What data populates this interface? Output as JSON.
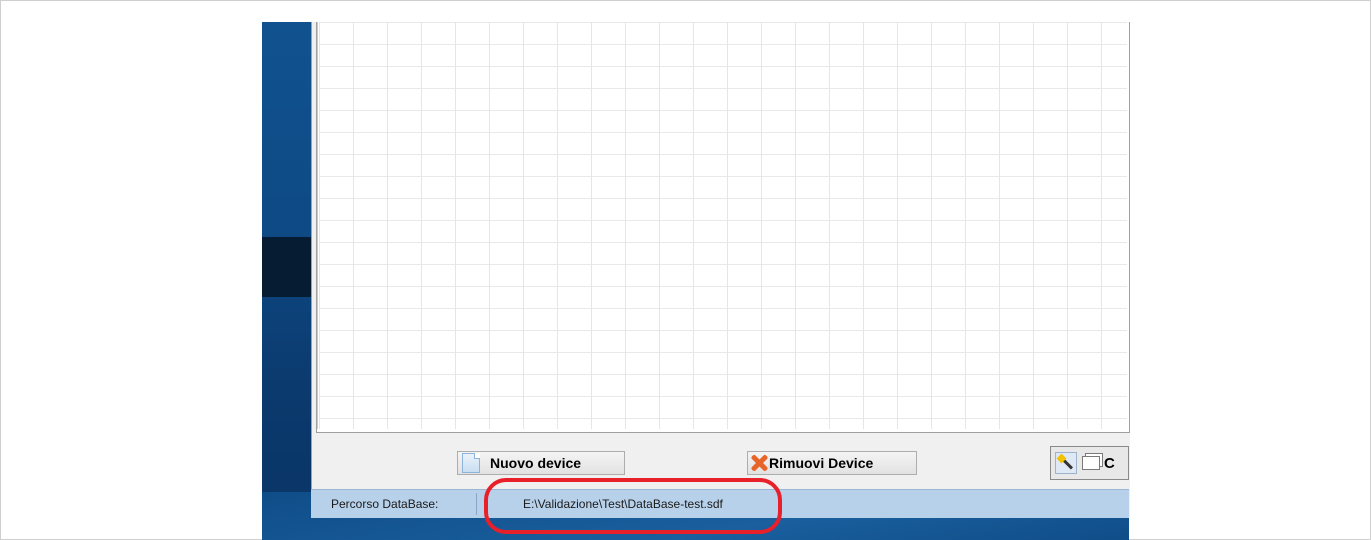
{
  "toolbar": {
    "new_device_label": "Nuovo device",
    "remove_device_label": "Rimuovi Device",
    "wizard_label_partial": "C"
  },
  "statusbar": {
    "db_path_label": "Percorso DataBase:",
    "db_path_value": "E:\\Validazione\\Test\\DataBase-test.sdf"
  },
  "icons": {
    "new_device": "new-document-icon",
    "remove_device": "delete-x-icon",
    "wizard": "magic-wand-icon",
    "window": "window-icon"
  },
  "colors": {
    "highlight": "#e8202a",
    "statusbar": "#b8d1ea",
    "desktop": "#10528f"
  }
}
